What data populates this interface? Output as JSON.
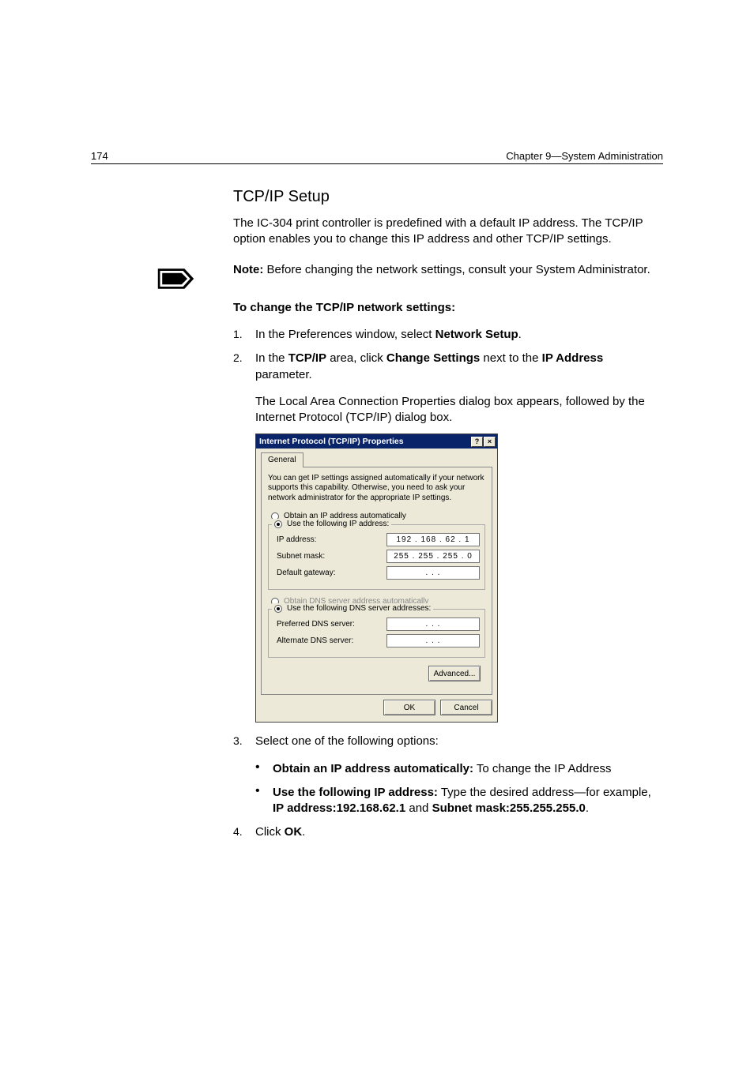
{
  "header": {
    "page_number": "174",
    "chapter": "Chapter 9—System Administration"
  },
  "section": {
    "title": "TCP/IP Setup",
    "intro": "The IC-304 print controller is predefined with a default IP address. The TCP/IP option enables you to change this IP address and other TCP/IP settings.",
    "note_label": "Note:",
    "note_text": "  Before changing the network settings, consult your System Administrator.",
    "procedure_title": "To change the TCP/IP network settings:"
  },
  "steps": {
    "s1_num": "1.",
    "s1_a": "In the Preferences window, select ",
    "s1_b": "Network Setup",
    "s1_c": ".",
    "s2_num": "2.",
    "s2_a": "In the ",
    "s2_b": "TCP/IP",
    "s2_c": " area, click ",
    "s2_d": "Change Settings",
    "s2_e": " next to the ",
    "s2_f": "IP Address",
    "s2_g": " parameter.",
    "s2_result": "The Local Area Connection Properties dialog box appears, followed by the Internet Protocol (TCP/IP) dialog box.",
    "s3_num": "3.",
    "s3_text": "Select one of the following options:",
    "s4_num": "4.",
    "s4_a": "Click ",
    "s4_b": "OK",
    "s4_c": "."
  },
  "bullets": {
    "b1_label": "Obtain an IP address automatically:",
    "b1_text": " To change the IP Address",
    "b2_label": "Use the following IP address:",
    "b2_a": " Type the desired address—for example, ",
    "b2_b": "IP address:192.168.62.1",
    "b2_c": " and ",
    "b2_d": "Subnet mask:255.255.255.0",
    "b2_e": "."
  },
  "dialog": {
    "title": "Internet Protocol (TCP/IP) Properties",
    "help_btn": "?",
    "close_btn": "×",
    "tab": "General",
    "desc": "You can get IP settings assigned automatically if your network supports this capability. Otherwise, you need to ask your network administrator for the appropriate IP settings.",
    "opt_auto_ip": "Obtain an IP address automatically",
    "opt_use_ip": "Use the following IP address:",
    "lbl_ip": "IP address:",
    "val_ip": "192 . 168 .  62 .   1",
    "lbl_mask": "Subnet mask:",
    "val_mask": "255 . 255 . 255 .   0",
    "lbl_gw": "Default gateway:",
    "val_gw": ".       .       .",
    "opt_auto_dns": "Obtain DNS server address automatically",
    "opt_use_dns": "Use the following DNS server addresses:",
    "lbl_pref_dns": "Preferred DNS server:",
    "val_pref_dns": ".       .       .",
    "lbl_alt_dns": "Alternate DNS server:",
    "val_alt_dns": ".       .       .",
    "btn_adv": "Advanced...",
    "btn_ok": "OK",
    "btn_cancel": "Cancel"
  }
}
